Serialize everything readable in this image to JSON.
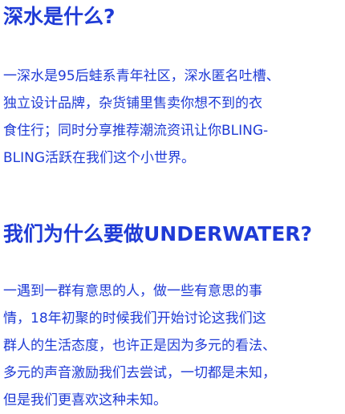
{
  "section_1": {
    "title": "深水是什么?",
    "lines": [
      "一深水是95后蛙系青年社区，深水匿名吐槽、",
      "独立设计品牌，杂货铺里售卖你想不到的衣",
      "食住行；同时分享推荐潮流资讯让你BLING-",
      "BLING活跃在我们这个小世界。"
    ]
  },
  "section_2": {
    "title": "我们为什么要做UNDERWATER?",
    "lines": [
      "一遇到一群有意思的人，做一些有意思的事",
      "情，18年初聚的时候我们开始讨论这我们这",
      "群人的生活态度，也许正是因为多元的看法、",
      "多元的声音激励我们去尝试，一切都是未知，",
      "但是我们更喜欢这种未知。"
    ]
  },
  "colors": {
    "text": "#1f3bd6",
    "background": "#ffffff"
  }
}
